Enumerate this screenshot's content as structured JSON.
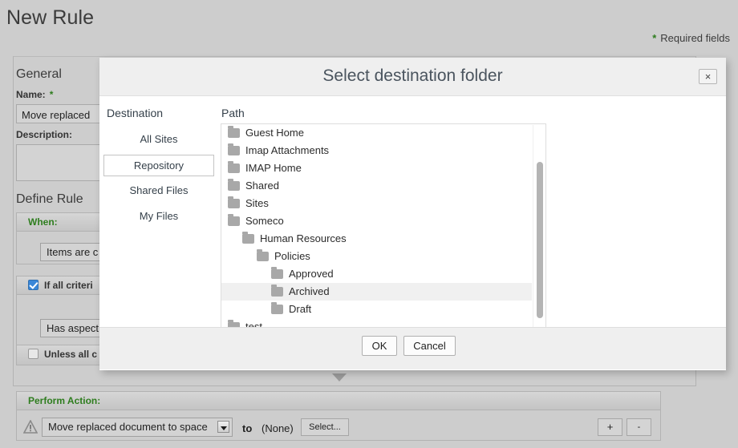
{
  "page": {
    "title": "New Rule",
    "required_note": "Required fields",
    "required_star": "*"
  },
  "general": {
    "heading": "General",
    "name_label": "Name:",
    "name_required_star": "*",
    "name_value": "Move replaced",
    "description_label": "Description:",
    "description_value": ""
  },
  "define_rule": {
    "heading": "Define Rule",
    "when_label": "When:",
    "when_value": "Items are c",
    "criteria_label": "If all criteri",
    "criteria_checked": true,
    "criteria_value": "Has aspect",
    "unless_label": "Unless all c",
    "unless_checked": false
  },
  "perform_action": {
    "band_label": "Perform Action:",
    "action_value": "Move replaced document to space",
    "to_label": "to",
    "target_value": "(None)",
    "select_button": "Select...",
    "add_button": "+",
    "remove_button": "-",
    "warning_icon": "warning-icon"
  },
  "dialog": {
    "title": "Select destination folder",
    "close_label": "×",
    "destination_heading": "Destination",
    "path_heading": "Path",
    "destinations": [
      {
        "label": "All Sites",
        "selected": false
      },
      {
        "label": "Repository",
        "selected": true
      },
      {
        "label": "Shared Files",
        "selected": false
      },
      {
        "label": "My Files",
        "selected": false
      }
    ],
    "tree": [
      {
        "label": "Guest Home",
        "depth": 0,
        "selected": false
      },
      {
        "label": "Imap Attachments",
        "depth": 0,
        "selected": false
      },
      {
        "label": "IMAP Home",
        "depth": 0,
        "selected": false
      },
      {
        "label": "Shared",
        "depth": 0,
        "selected": false
      },
      {
        "label": "Sites",
        "depth": 0,
        "selected": false
      },
      {
        "label": "Someco",
        "depth": 0,
        "selected": false
      },
      {
        "label": "Human Resources",
        "depth": 1,
        "selected": false
      },
      {
        "label": "Policies",
        "depth": 2,
        "selected": false
      },
      {
        "label": "Approved",
        "depth": 3,
        "selected": false
      },
      {
        "label": "Archived",
        "depth": 3,
        "selected": true
      },
      {
        "label": "Draft",
        "depth": 3,
        "selected": false
      },
      {
        "label": "test",
        "depth": 0,
        "selected": false
      }
    ],
    "ok_label": "OK",
    "cancel_label": "Cancel"
  },
  "colors": {
    "accent_green": "#2e7d1e",
    "checkbox_blue": "#3a87d8",
    "selected_row": "#f0f0f0",
    "page_bg": "#cdcdcd",
    "dialog_header_bg": "#efefef"
  }
}
